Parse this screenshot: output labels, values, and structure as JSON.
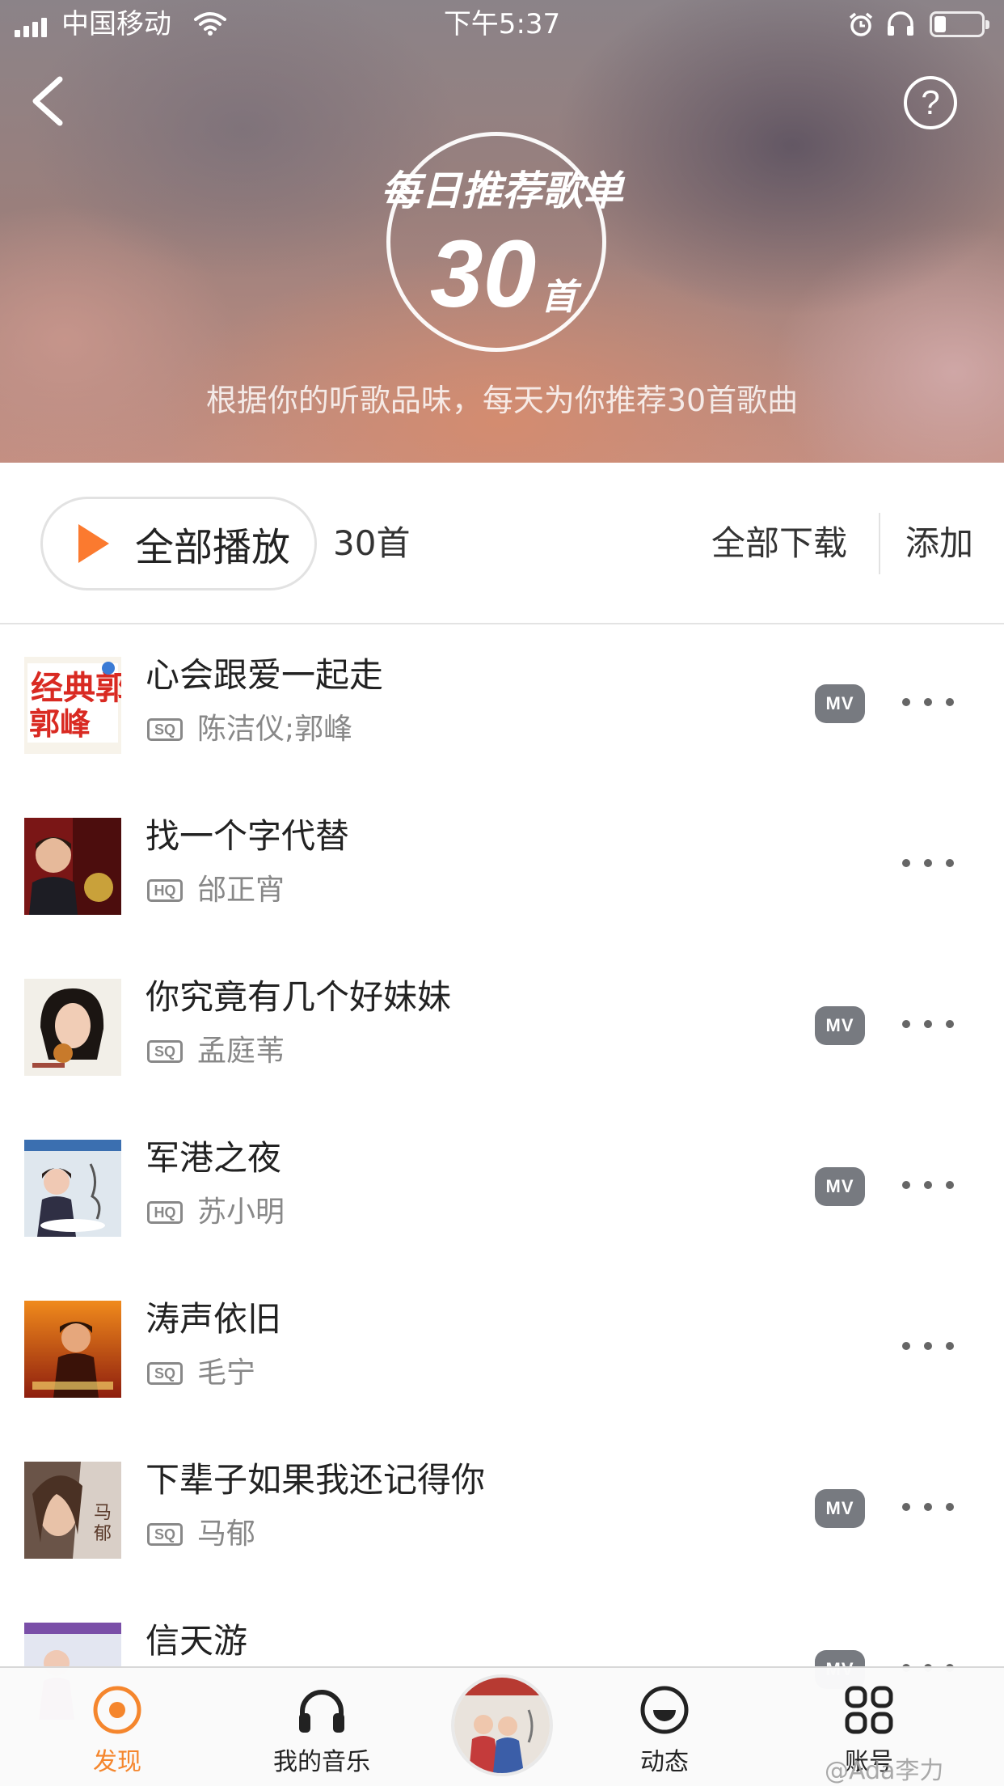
{
  "status_bar": {
    "carrier": "中国移动",
    "time": "下午5:37",
    "battery_level": 0.25
  },
  "header": {
    "badge_title": "每日推荐歌单",
    "badge_count": "30",
    "badge_unit": "首",
    "subtitle": "根据你的听歌品味，每天为你推荐30首歌曲"
  },
  "toolbar": {
    "play_all_label": "全部播放",
    "song_count": "30首",
    "download_all_label": "全部下载",
    "add_label": "添加"
  },
  "songs": [
    {
      "title": "心会跟爱一起走",
      "quality": "SQ",
      "artist": "陈洁仪;郭峰",
      "mv": "MV"
    },
    {
      "title": "找一个字代替",
      "quality": "HQ",
      "artist": "邰正宵",
      "mv": ""
    },
    {
      "title": "你究竟有几个好妹妹",
      "quality": "SQ",
      "artist": "孟庭苇",
      "mv": "MV"
    },
    {
      "title": "军港之夜",
      "quality": "HQ",
      "artist": "苏小明",
      "mv": "MV"
    },
    {
      "title": "涛声依旧",
      "quality": "SQ",
      "artist": "毛宁",
      "mv": ""
    },
    {
      "title": "下辈子如果我还记得你",
      "quality": "SQ",
      "artist": "马郁",
      "mv": "MV"
    },
    {
      "title": "信天游",
      "quality": "",
      "artist": "",
      "mv": "MV"
    }
  ],
  "cover_texts": {
    "cover1": "经典郭峰"
  },
  "tabbar": {
    "tabs": [
      {
        "label": "发现",
        "icon": "discover-icon",
        "active": true
      },
      {
        "label": "我的音乐",
        "icon": "headphones-icon",
        "active": false
      },
      {
        "label": "动态",
        "icon": "feed-icon",
        "active": false
      },
      {
        "label": "账号",
        "icon": "grid-icon",
        "active": false
      }
    ],
    "accent": "#f5862d"
  },
  "watermark": "@Ada李力",
  "colors": {
    "play_accent": "#fb7a2f",
    "mv_badge": "#777a80"
  }
}
